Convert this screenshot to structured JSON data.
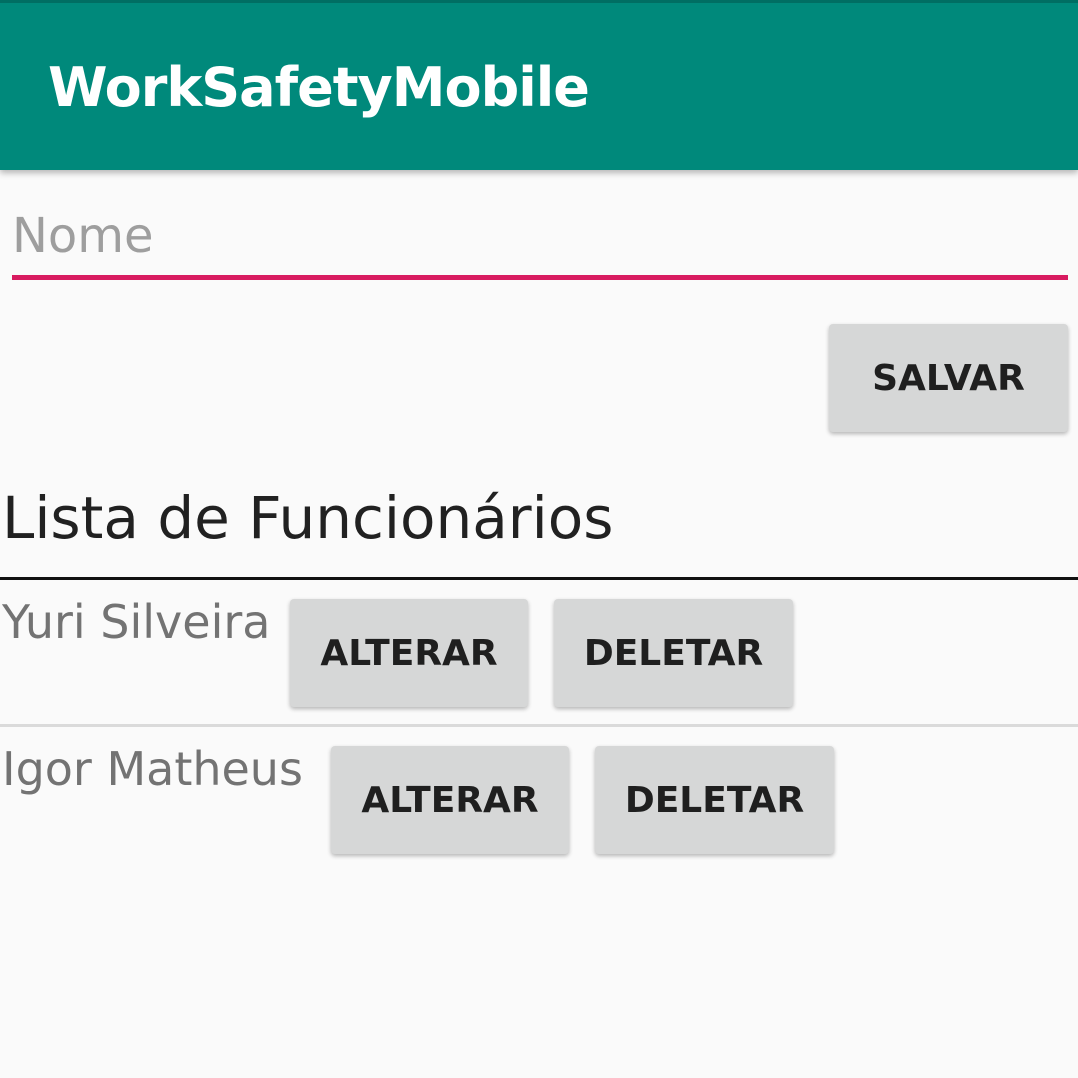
{
  "appbar": {
    "title": "WorkSafetyMobile"
  },
  "form": {
    "name_placeholder": "Nome",
    "name_value": "",
    "save_label": "SALVAR"
  },
  "list": {
    "title": "Lista de Funcionários",
    "employees": [
      {
        "name": "Yuri Silveira",
        "edit_label": "ALTERAR",
        "delete_label": "DELETAR"
      },
      {
        "name": "Igor Matheus",
        "edit_label": "ALTERAR",
        "delete_label": "DELETAR"
      }
    ]
  },
  "colors": {
    "appbar": "#00897b",
    "input_underline": "#d81b60",
    "button_bg": "#d6d7d7",
    "background": "#fafafa"
  }
}
